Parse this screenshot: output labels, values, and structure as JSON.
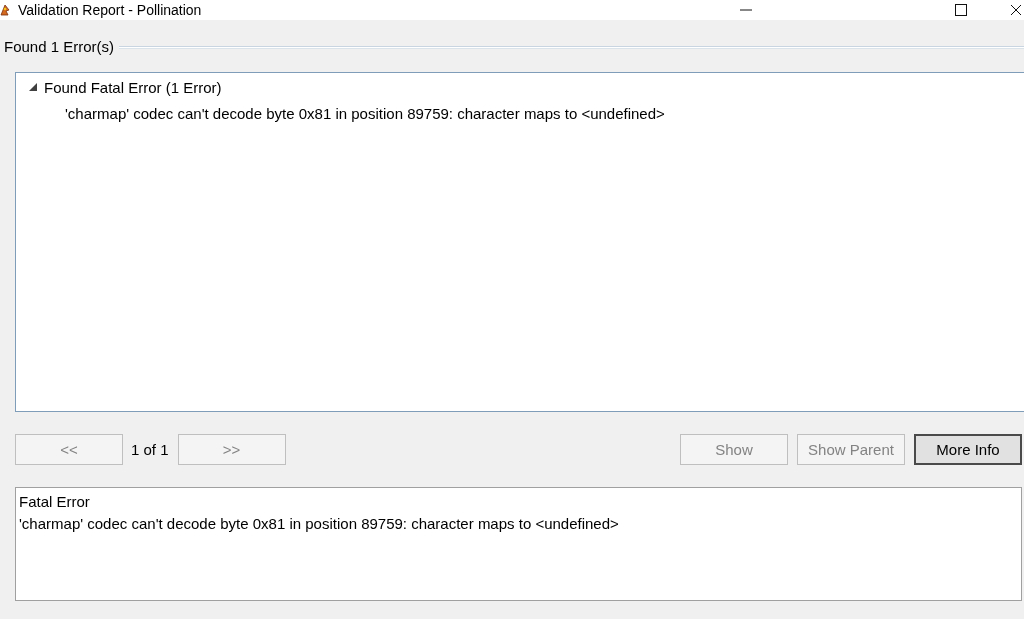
{
  "window": {
    "title": "Validation Report - Pollination"
  },
  "group": {
    "label": "Found 1 Error(s)"
  },
  "tree": {
    "items": [
      {
        "label": "Found Fatal Error (1 Error)",
        "expanded": true,
        "children": [
          {
            "label": "'charmap' codec can't decode byte 0x81 in position 89759: character maps to <undefined>"
          }
        ]
      }
    ]
  },
  "navigation": {
    "previous": {
      "label": "<<",
      "disabled": true
    },
    "page": "1 of 1",
    "next": {
      "label": ">>",
      "disabled": true
    }
  },
  "actions": [
    {
      "label": "Show",
      "disabled": true,
      "default": false
    },
    {
      "label": "Show Parent",
      "disabled": true,
      "default": false
    },
    {
      "label": "More Info",
      "disabled": false,
      "default": true
    }
  ],
  "details": {
    "title": "Fatal Error",
    "message": "'charmap' codec can't decode byte 0x81 in position 89759: character maps to <undefined>"
  }
}
